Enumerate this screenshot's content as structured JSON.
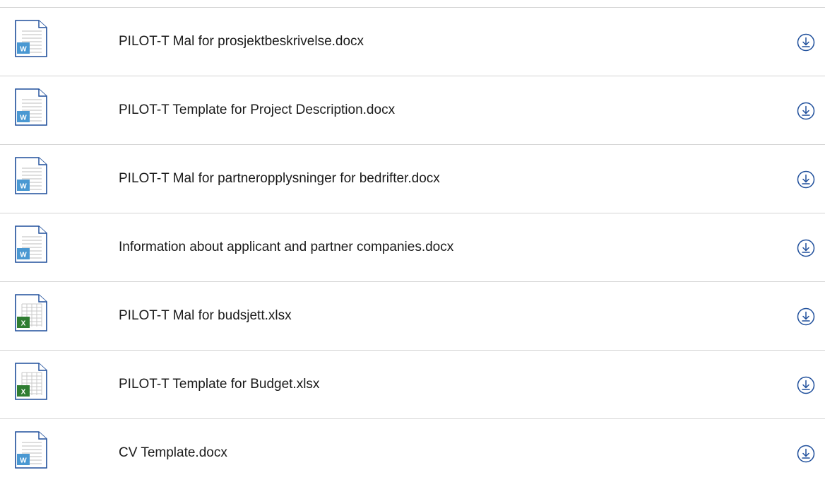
{
  "colors": {
    "word_blue": "#1e4e9b",
    "word_badge": "#4a98d2",
    "excel_green": "#2f7d32",
    "divider": "#d4d4d4",
    "accent": "#1e4e9b"
  },
  "files": [
    {
      "name": "PILOT-T Mal for prosjektbeskrivelse.docx",
      "type": "word",
      "icon": "word-document-icon",
      "badge": "W"
    },
    {
      "name": "PILOT-T Template for Project Description.docx",
      "type": "word",
      "icon": "word-document-icon",
      "badge": "W"
    },
    {
      "name": "PILOT-T Mal for partneropplysninger for bedrifter.docx",
      "type": "word",
      "icon": "word-document-icon",
      "badge": "W"
    },
    {
      "name": "Information about applicant and partner companies.docx",
      "type": "word",
      "icon": "word-document-icon",
      "badge": "W"
    },
    {
      "name": "PILOT-T Mal for budsjett.xlsx",
      "type": "excel",
      "icon": "excel-spreadsheet-icon",
      "badge": "X"
    },
    {
      "name": "PILOT-T Template for Budget.xlsx",
      "type": "excel",
      "icon": "excel-spreadsheet-icon",
      "badge": "X"
    },
    {
      "name": "CV Template.docx",
      "type": "word",
      "icon": "word-document-icon",
      "badge": "W"
    }
  ]
}
